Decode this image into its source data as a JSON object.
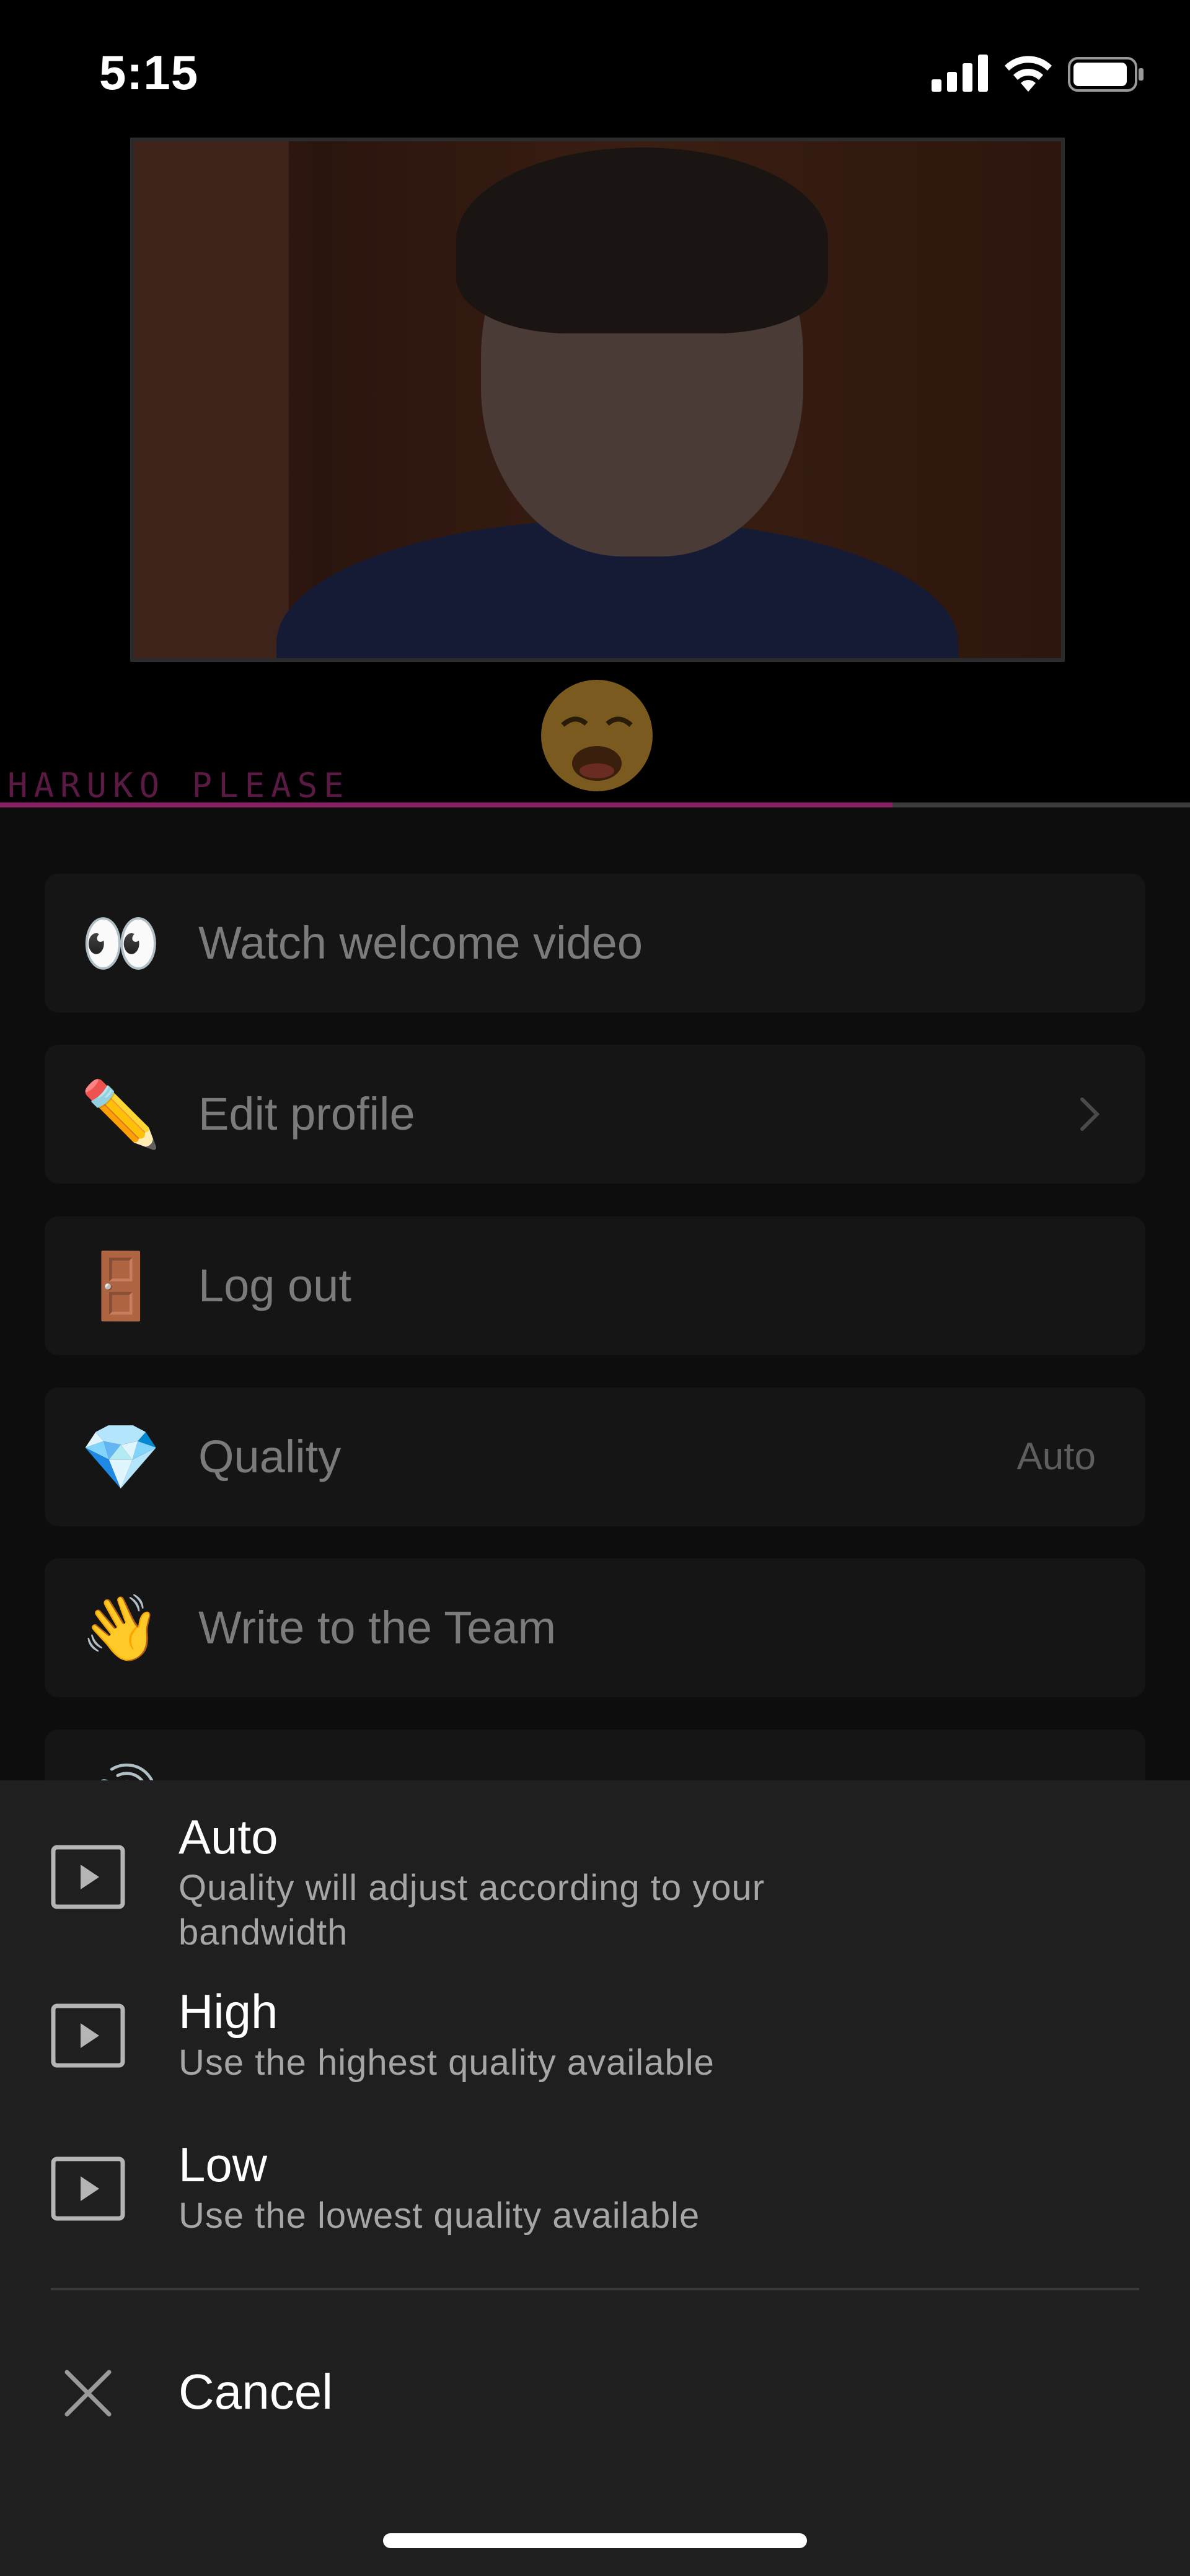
{
  "status_bar": {
    "time": "5:15"
  },
  "header": {
    "watermark": "HARUKO PLEASE",
    "reaction_emoji": "😩",
    "video_progress": 0.75,
    "progress_color": "#8b1f63"
  },
  "menu": {
    "items": [
      {
        "emoji": "👀",
        "label": "Watch welcome video"
      },
      {
        "emoji": "✏️",
        "label": "Edit profile"
      },
      {
        "emoji": "🚪",
        "label": "Log out"
      },
      {
        "emoji": "💎",
        "label": "Quality",
        "value": "Auto"
      },
      {
        "emoji": "👋",
        "label": "Write to the Team"
      },
      {
        "emoji": "🔊",
        "label": ""
      }
    ]
  },
  "quality_sheet": {
    "options": [
      {
        "title": "Auto",
        "description": "Quality will adjust according to your bandwidth",
        "icon": "play-square-icon"
      },
      {
        "title": "High",
        "description": "Use the highest quality available",
        "icon": "play-square-icon"
      },
      {
        "title": "Low",
        "description": "Use the lowest quality available",
        "icon": "play-square-icon"
      }
    ],
    "cancel_label": "Cancel"
  },
  "colors": {
    "sheet_background": "#1f1f1f",
    "menu_item_background": "#151515",
    "accent": "#8b1f63"
  }
}
